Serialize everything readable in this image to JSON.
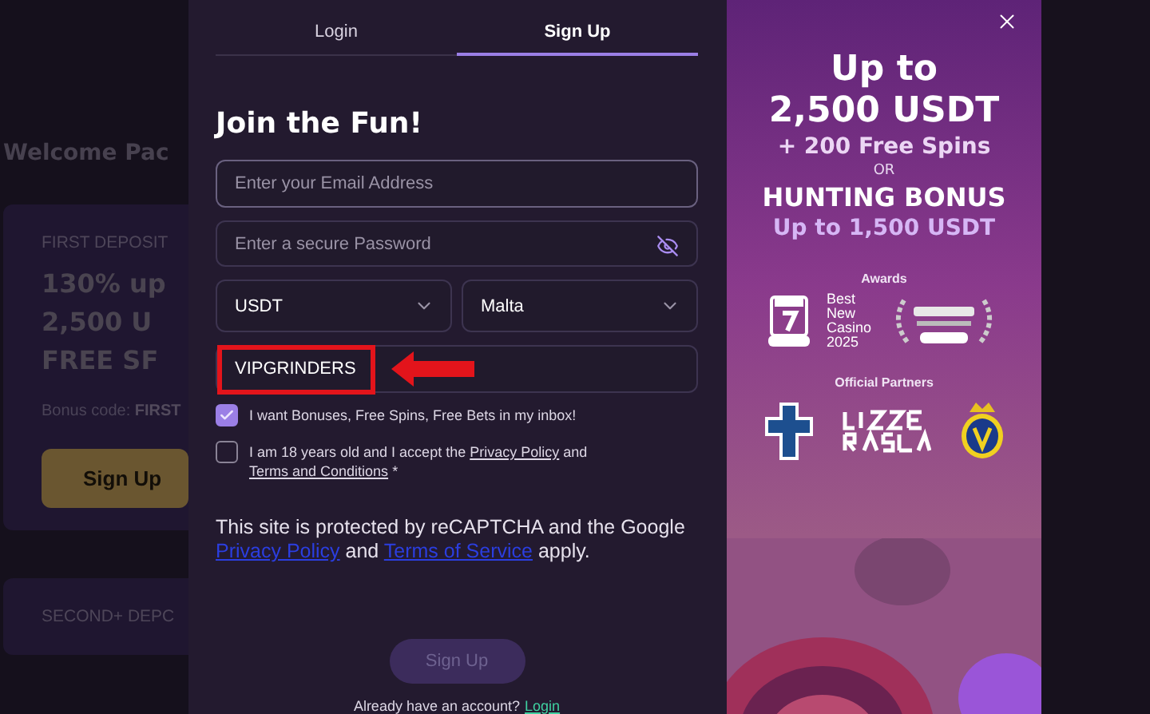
{
  "background": {
    "title": "Welcome Pac",
    "cards": [
      {
        "label": "FIRST DEPOSIT",
        "headline": [
          "130% up",
          "2,500 U",
          "FREE SF"
        ],
        "bonus_label": "Bonus code:",
        "bonus_code": "FIRST",
        "button": "Sign Up"
      },
      {
        "label": "SECOND+ DEPC"
      }
    ]
  },
  "modal": {
    "tabs": [
      {
        "label": "Login",
        "selected": false
      },
      {
        "label": "Sign Up",
        "selected": true
      }
    ],
    "heading": "Join the Fun!",
    "email": {
      "placeholder": "Enter your Email Address"
    },
    "password": {
      "placeholder": "Enter a secure Password"
    },
    "currency": {
      "value": "USDT"
    },
    "country": {
      "value": "Malta"
    },
    "promo_code": {
      "value": "VIPGRINDERS",
      "highlighted": true
    },
    "consents": [
      {
        "text": "I want Bonuses, Free Spins, Free Bets in my inbox!",
        "checked": true
      },
      {
        "text": "I am 18 years old and I accept the",
        "link_1": "Privacy Policy",
        "joiner": "and",
        "link_2": "Terms and Conditions",
        "required_mark": "*",
        "checked": false
      }
    ],
    "recaptcha": {
      "text": "This site is protected by reCAPTCHA and the Google",
      "link_1": "Privacy Policy",
      "joiner": "and",
      "link_2": "Terms of Service",
      "tail": "apply."
    },
    "submit": {
      "label": "Sign Up",
      "disabled": true
    },
    "footer": {
      "text": "Already have an account?",
      "link": "Login"
    }
  },
  "promo": {
    "lines": [
      {
        "kind": "big",
        "text": "Up to"
      },
      {
        "kind": "big",
        "text": "2,500 USDT"
      },
      {
        "kind": "sub",
        "text": "+ 200 Free Spins"
      },
      {
        "kind": "small",
        "text": "OR"
      },
      {
        "kind": "mid",
        "text": "HUNTING BONUS"
      },
      {
        "kind": "accent",
        "text": "Up to 1,500 USDT"
      }
    ],
    "awards_label": "Awards",
    "award_text": [
      "Best",
      "New",
      "Casino",
      "2025"
    ],
    "partners_label": "Official Partners"
  }
}
